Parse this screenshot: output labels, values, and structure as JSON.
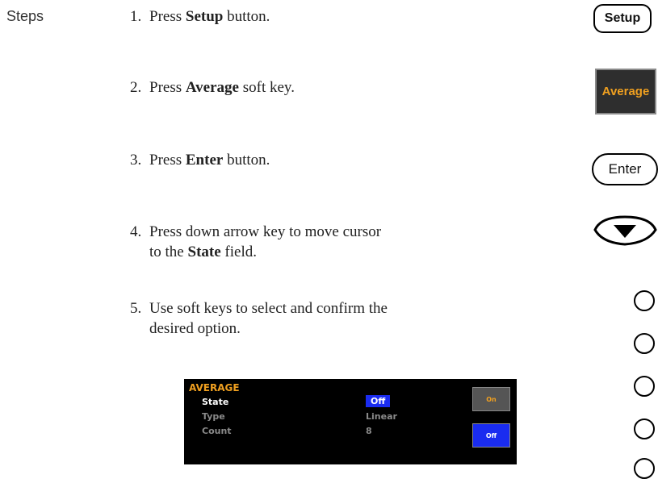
{
  "section_label": "Steps",
  "steps": [
    {
      "num": "1.",
      "pre": "Press ",
      "bold": "Setup",
      "post": " button."
    },
    {
      "num": "2.",
      "pre": "Press ",
      "bold": "Average",
      "post": " soft key."
    },
    {
      "num": "3.",
      "pre": "Press ",
      "bold": "Enter",
      "post": " button."
    },
    {
      "num": "4.",
      "line1": "Press down arrow key to move cursor",
      "pre2": "to the ",
      "bold": "State",
      "post": " field."
    },
    {
      "num": "5.",
      "line1": "Use soft keys to select and confirm the",
      "line2": "desired option."
    }
  ],
  "buttons": {
    "setup": "Setup",
    "average": "Average",
    "enter": "Enter"
  },
  "screen": {
    "title": "AVERAGE",
    "rows": [
      {
        "label": "State",
        "value": "Off"
      },
      {
        "label": "Type",
        "value": "Linear"
      },
      {
        "label": "Count",
        "value": "8"
      }
    ],
    "softkeys": {
      "on": "On",
      "off": "Off"
    }
  },
  "colors": {
    "accent": "#f0a020",
    "selected": "#1a2cf0"
  }
}
